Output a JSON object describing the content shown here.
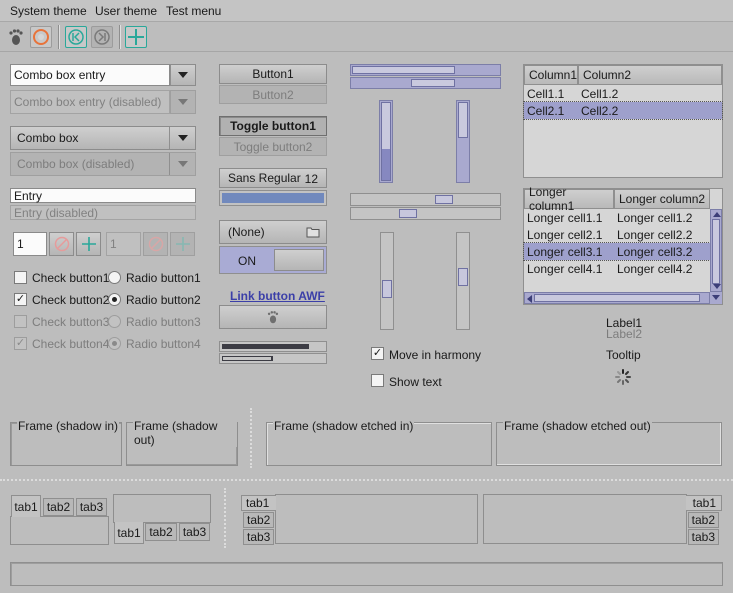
{
  "menubar": {
    "items": [
      "System theme",
      "User theme",
      "Test menu"
    ]
  },
  "toolbar": {
    "icons": [
      "gnome-foot-icon",
      "stop-icon",
      "skip-back-icon",
      "skip-forward-icon",
      "add-icon"
    ],
    "accent": "#2aa89a"
  },
  "combos": {
    "entry_combo": "Combo box entry",
    "entry_combo_disabled": "Combo box entry (disabled)",
    "combo": "Combo box",
    "combo_disabled": "Combo box (disabled)"
  },
  "entries": {
    "entry": "Entry",
    "entry_disabled": "Entry (disabled)"
  },
  "spin": {
    "value": "1",
    "value_disabled": "1"
  },
  "checks": [
    {
      "check": "Check button1",
      "checked": false,
      "radio": "Radio button1",
      "selected": false
    },
    {
      "check": "Check button2",
      "checked": true,
      "radio": "Radio button2",
      "selected": true
    },
    {
      "check": "Check button3",
      "checked": false,
      "radio": "Radio button3",
      "selected": false
    },
    {
      "check": "Check button4",
      "checked": true,
      "radio": "Radio button4",
      "selected": true
    }
  ],
  "buttons": {
    "button1": "Button1",
    "button2": "Button2",
    "toggle1": "Toggle button1",
    "toggle2": "Toggle button2",
    "font_name": "Sans Regular",
    "font_size": "12",
    "file_chooser": "(None)",
    "switch_on": "ON",
    "link": "Link button AWF"
  },
  "progress": {
    "bar1_fraction": 0.85,
    "bar2_fraction": 0.5
  },
  "scales": {
    "h1_fraction": 0.7,
    "h2_fraction": 0.4,
    "v1_fraction": 0.6,
    "v2_fraction": 0.45
  },
  "options": {
    "move_in_harmony": "Move in harmony",
    "move_checked": true,
    "show_text": "Show text",
    "show_checked": false
  },
  "tree1": {
    "columns": [
      "Column1",
      "Column2"
    ],
    "rows": [
      [
        "Cell1.1",
        "Cell1.2"
      ],
      [
        "Cell2.1",
        "Cell2.2"
      ]
    ],
    "selected_row": 1
  },
  "tree2": {
    "columns": [
      "Longer column1",
      "Longer column2"
    ],
    "rows": [
      [
        "Longer cell1.1",
        "Longer cell1.2"
      ],
      [
        "Longer cell2.1",
        "Longer cell2.2"
      ],
      [
        "Longer cell3.1",
        "Longer cell3.2"
      ],
      [
        "Longer cell4.1",
        "Longer cell4.2"
      ]
    ],
    "selected_row": 2
  },
  "labels": {
    "label1": "Label1",
    "label2": "Label2",
    "tooltip": "Tooltip"
  },
  "frames": [
    "Frame (shadow in)",
    "Frame (shadow out)",
    "Frame (shadow etched in)",
    "Frame (shadow etched out)"
  ],
  "tabs": [
    "tab1",
    "tab2",
    "tab3"
  ],
  "colors": {
    "selection": "#9ea0cc",
    "slider": "#8688c0",
    "link": "#3b3fa8"
  }
}
